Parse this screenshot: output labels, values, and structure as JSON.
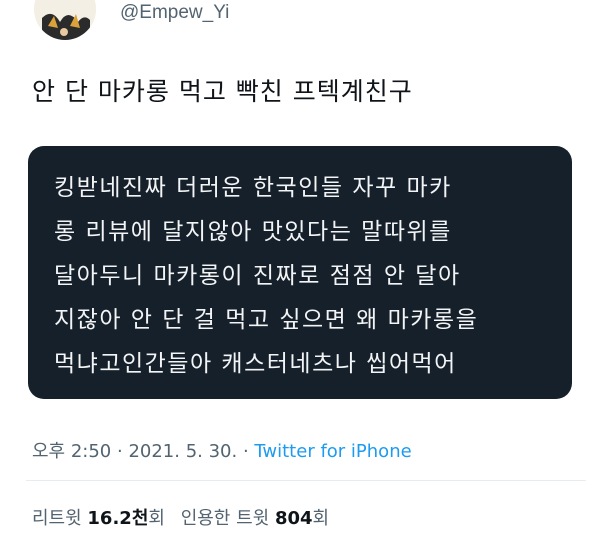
{
  "author": {
    "handle": "@Empew_Yi"
  },
  "tweet": {
    "text": "안 단 마카롱 먹고 빡친 프텍계친구"
  },
  "quoted_text_lines": [
    "킹받네진짜 더러운 한국인들 자꾸 마카",
    "롱 리뷰에 달지않아 맛있다는 말따위를",
    "달아두니 마카롱이 진짜로 점점 안 달아",
    "지잖아 안 단 걸 먹고 싶으면 왜 마카롱을",
    "먹냐고인간들아 캐스터네츠나 씹어먹어"
  ],
  "meta": {
    "time": "오후 2:50",
    "sep1": " · ",
    "date": "2021. 5. 30.",
    "sep2": " · ",
    "source": "Twitter for iPhone"
  },
  "stats": {
    "retweets_label": "리트윗 ",
    "retweets_value": "16.2천",
    "retweets_unit": "회",
    "quotes_label": "인용한 트윗 ",
    "quotes_value": "804",
    "quotes_unit": "회"
  },
  "colors": {
    "quote_bg": "#16202a",
    "link": "#1d9bf0",
    "muted": "#536471"
  }
}
